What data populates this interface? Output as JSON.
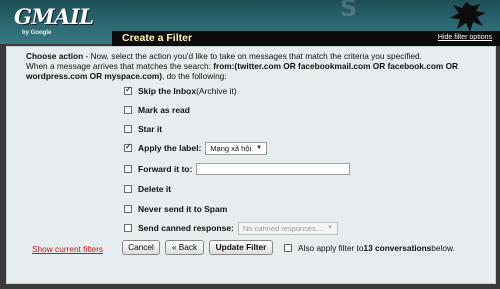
{
  "header": {
    "logo": "GMAIL",
    "logo_sub": "by Google",
    "deco": "S"
  },
  "titlebar": {
    "title": "Create a Filter",
    "hide_link": "Hide filter options"
  },
  "intro": {
    "lead_bold": "Choose action",
    "line1": " - Now, select the action you'd like to take on messages that match the criteria you specified.",
    "line2a": "When a message arrives that matches the search: ",
    "search_bold": "from:(twitter.com OR facebookmail.com OR facebook.com OR wordpress.com OR myspace.com)",
    "line2b": ", do the following:"
  },
  "actions": {
    "skip_inbox": "Skip the Inbox",
    "skip_inbox_sub": " (Archive it)",
    "mark_read": "Mark as read",
    "star": "Star it",
    "apply_label": "Apply the label:",
    "label_value": "Mạng xã hội",
    "forward": "Forward it to:",
    "forward_value": "",
    "delete": "Delete it",
    "never_spam": "Never send it to Spam",
    "canned": "Send canned response:",
    "canned_value": "No canned responses..."
  },
  "footer": {
    "show_filters": "Show current filters",
    "cancel": "Cancel",
    "back": "« Back",
    "update": "Update Filter",
    "also_a": "Also apply filter to ",
    "also_count": "13 conversations",
    "also_b": " below."
  },
  "colors": {
    "accent_title": "#fff6b0",
    "panel_bg": "#e7edef",
    "link_red": "#c01818"
  }
}
